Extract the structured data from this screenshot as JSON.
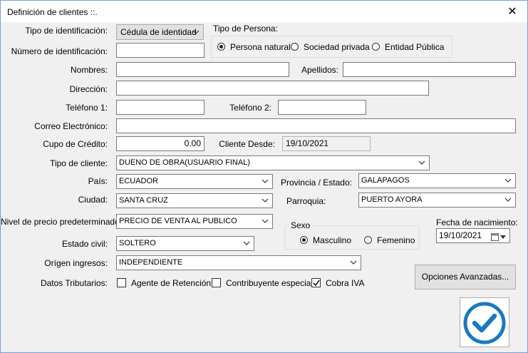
{
  "window": {
    "title": "Definición de clientes ::.",
    "close_glyph": "✕"
  },
  "form": {
    "tipo_identificacion": {
      "label": "Tipo de identificación:",
      "value": "Cédula de identidad"
    },
    "tipo_persona": {
      "label": "Tipo de Persona:",
      "options": [
        {
          "label": "Persona natural",
          "selected": true
        },
        {
          "label": "Sociedad privada",
          "selected": false
        },
        {
          "label": "Entidad Pública",
          "selected": false
        }
      ]
    },
    "numero_identificacion": {
      "label": "Número de identificación:",
      "value": ""
    },
    "nombres": {
      "label": "Nombres:",
      "value": ""
    },
    "apellidos": {
      "label": "Apellidos:",
      "value": ""
    },
    "direccion": {
      "label": "Dirección:",
      "value": ""
    },
    "telefono1": {
      "label": "Teléfono 1:",
      "value": ""
    },
    "telefono2": {
      "label": "Teléfono 2:",
      "value": ""
    },
    "correo": {
      "label": "Correo Electrónico:",
      "value": ""
    },
    "cupo_credito": {
      "label": "Cupo de Crédito:",
      "value": "0.00"
    },
    "cliente_desde": {
      "label": "Cliente Desde:",
      "value": "19/10/2021"
    },
    "tipo_cliente": {
      "label": "Tipo de cliente:",
      "value": "DUENO DE OBRA(USUARIO FINAL)"
    },
    "pais": {
      "label": "País:",
      "value": "ECUADOR"
    },
    "provincia": {
      "label": "Provincia / Estado:",
      "value": "GALAPAGOS"
    },
    "ciudad": {
      "label": "Ciudad:",
      "value": "SANTA CRUZ"
    },
    "parroquia": {
      "label": "Parroquia:",
      "value": "PUERTO AYORA"
    },
    "nivel_precio": {
      "label": "Nivel de precio predeterminado:",
      "value": "PRECIO DE VENTA AL PUBLICO"
    },
    "sexo": {
      "label": "Sexo",
      "options": [
        {
          "label": "Masculino",
          "selected": true
        },
        {
          "label": "Femenino",
          "selected": false
        }
      ]
    },
    "fecha_nacimiento": {
      "label": "Fecha de nacimiento:",
      "value": "19/10/2021"
    },
    "estado_civil": {
      "label": "Estado civil:",
      "value": "SOLTERO"
    },
    "origen_ingresos": {
      "label": "Orígen ingresos:",
      "value": "INDEPENDIENTE"
    },
    "datos_tributarios": {
      "label": "Datos Tributarios:",
      "options": [
        {
          "label": "Agente de Retención",
          "checked": false
        },
        {
          "label": "Contribuyente especial",
          "checked": false
        },
        {
          "label": "Cobra IVA",
          "checked": true
        }
      ]
    }
  },
  "buttons": {
    "opciones_avanzadas": "Opciones Avanzadas..."
  },
  "colors": {
    "accent": "#1a78c2",
    "window_border": "#7a9ed6"
  }
}
